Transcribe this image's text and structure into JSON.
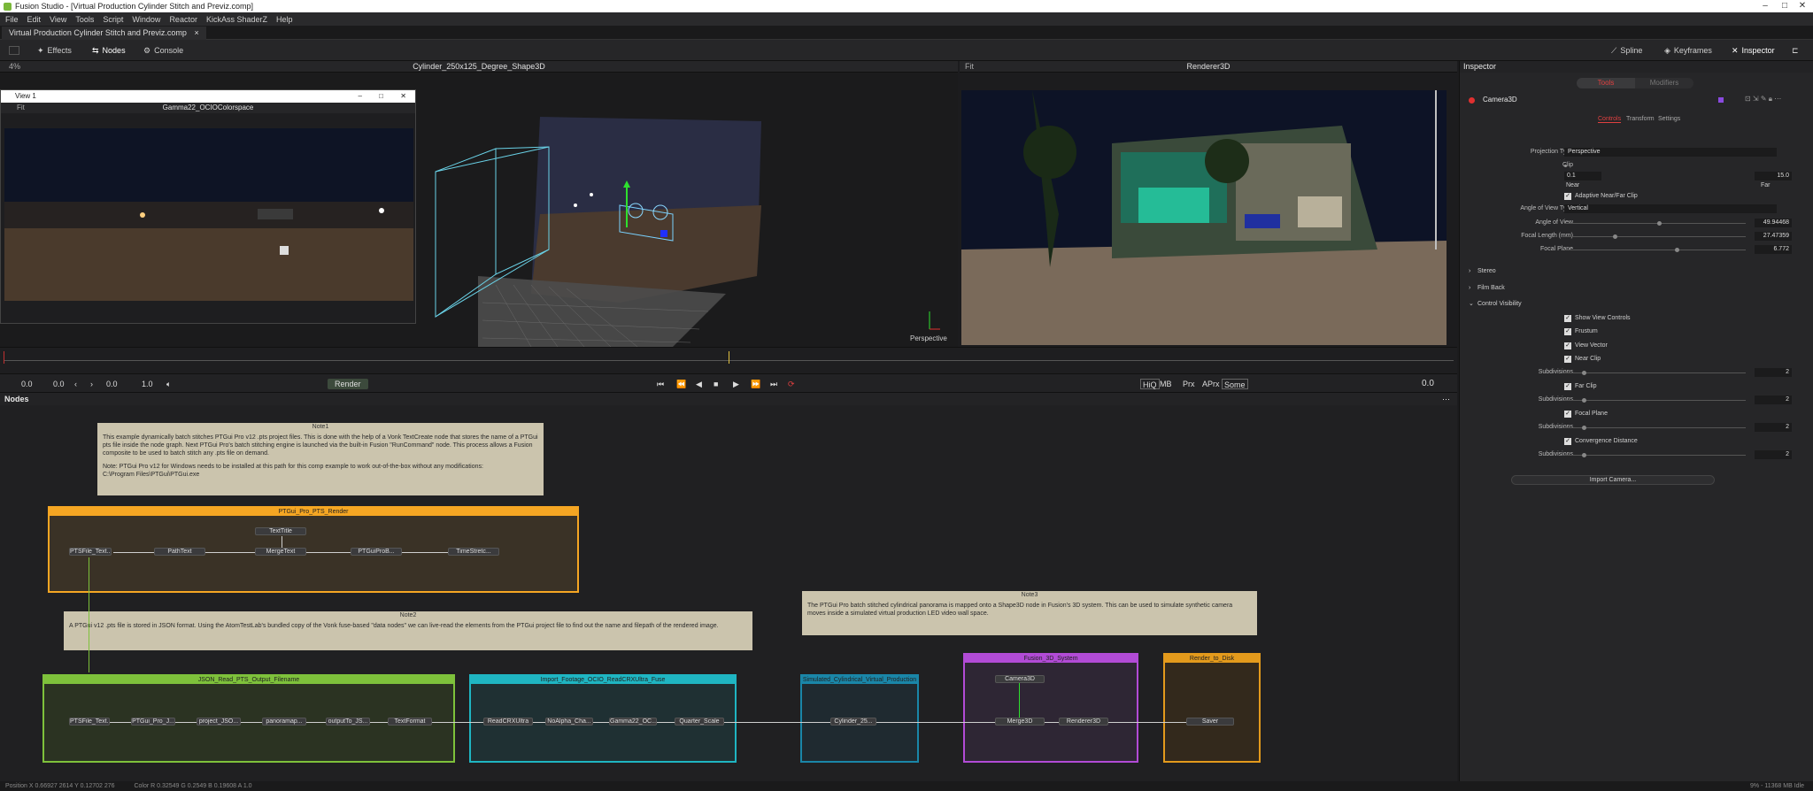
{
  "window": {
    "title": "Fusion Studio - [Virtual Production Cylinder Stitch and Previz.comp]"
  },
  "menu": [
    "File",
    "Edit",
    "View",
    "Tools",
    "Script",
    "Window",
    "Reactor",
    "KickAss ShaderZ",
    "Help"
  ],
  "doc_tab": {
    "label": "Virtual Production Cylinder Stitch and Previz.comp",
    "close": "×"
  },
  "toolbar": {
    "effects": "Effects",
    "nodes": "Nodes",
    "console": "Console",
    "spline": "Spline",
    "keyframes": "Keyframes",
    "inspector": "Inspector"
  },
  "viewer_left": {
    "title": "Cylinder_250x125_Degree_Shape3D",
    "perspective": "Perspective",
    "zoom": "4%"
  },
  "viewer_right": {
    "title": "Renderer3D",
    "fit": "Fit"
  },
  "floating_view": {
    "title": "View 1",
    "label": "Gamma22_OCIOColorspace",
    "fit": "Fit"
  },
  "transport": {
    "start": "0.0",
    "render_start": "0.0",
    "current": "0.0",
    "end": "1.0",
    "render_btn": "Render",
    "hiq": "HiQ",
    "mb": "MB",
    "prx": "Prx",
    "aprx": "APrx",
    "some": "Some",
    "time": "0.0"
  },
  "nodes_panel": {
    "title": "Nodes"
  },
  "notes": {
    "note1": {
      "title": "Note1",
      "p1": "This example dynamically batch stitches PTGui Pro v12 .pts project files. This is done with the help of a Vonk TextCreate node that stores the name of a PTGui pts file inside the node graph. Next PTGui Pro's batch stitching engine is launched via the built-in Fusion \"RunCommand\" node. This process allows a Fusion composite to be used to batch stitch any .pts file on demand.",
      "p2": "Note: PTGui Pro v12 for Windows needs to be installed at this path for this comp example to work out-of-the-box without any modifications:",
      "p3": "C:\\Program Files\\PTGui\\PTGui.exe"
    },
    "note2": {
      "title": "Note2",
      "p1": "A PTGui v12 .pts file is stored in JSON format. Using the AtomTestLab's bundled copy of the Vonk fuse-based \"data nodes\" we can live-read the elements from the PTGui project file to find out the name and filepath of the rendered image."
    },
    "note3": {
      "title": "Note3",
      "p1": "The PTGui Pro batch stitched cylindrical panorama is mapped onto a Shape3D node in Fusion's 3D system. This can be used to simulate synthetic camera moves inside a simulated virtual production LED video wall space."
    }
  },
  "groups": {
    "ptgui": {
      "title": "PTGui_Pro_PTS_Render",
      "color": "#f5a623"
    },
    "json": {
      "title": "JSON_Read_PTS_Output_Filename",
      "color": "#7ec13b"
    },
    "import": {
      "title": "Import_Footage_OCIO_ReadCRXUltra_Fuse",
      "color": "#1fb5c2"
    },
    "simulate": {
      "title": "Simulated_Cylindrical_Virtual_Production",
      "color": "#1a86a8"
    },
    "fusion3d": {
      "title": "Fusion_3D_System",
      "color": "#b24bd6"
    },
    "render": {
      "title": "Render_to_Disk",
      "color": "#e39a1c"
    }
  },
  "nodes": {
    "ptsfile_text_a": "PTSFile_Text...",
    "pathtext": "PathText",
    "texttitle": "TextTitle",
    "mergetext": "MergeText",
    "ptguiprob": "PTGuiProB...",
    "timestretch": "TimeStretc...",
    "ptsfile_text_b": "PTSFile_Text...",
    "ptgui_pro": "PTGui_Pro_J...",
    "project_json": "project_JSO...",
    "panorama": "panoramap...",
    "outputto": "outputTo_JS...",
    "textformat": "TextFormat",
    "readcrx": "ReadCRXUltra",
    "noalpha": "NoAlpha_Cha...",
    "gamma22": "Gamma22_OC...",
    "quarter": "Quarter_Scale",
    "cylinder": "Cylinder_25...",
    "camera3d": "Camera3D",
    "merge3d": "Merge3D",
    "renderer3d": "Renderer3D",
    "saver": "Saver"
  },
  "inspector": {
    "title": "Inspector",
    "tab_tools": "Tools",
    "tab_modifiers": "Modifiers",
    "node_name": "Camera3D",
    "subtabs": [
      "Controls",
      "Transform",
      "Settings"
    ],
    "projection_type_label": "Projection Type",
    "projection_type": "Perspective",
    "clip_label": "Clip",
    "near_val": "0.1",
    "far_val": "15.0",
    "near_label": "Near",
    "far_label": "Far",
    "adaptive": "Adaptive Near/Far Clip",
    "angle_type_label": "Angle of View Type",
    "angle_type": "Vertical",
    "angle_label": "Angle of View",
    "angle_val": "49.94468",
    "focal_label": "Focal Length (mm)",
    "focal_val": "27.47359",
    "plane_label": "Focal Plane",
    "plane_val": "6.772",
    "stereo": "Stereo",
    "filmback": "Film Back",
    "control_vis": "Control Visibility",
    "show_view": "Show View Controls",
    "frustum": "Frustum",
    "view_vector": "View Vector",
    "near_clip": "Near Clip",
    "subdiv_label": "Subdivisions",
    "subdiv_val": "2",
    "far_clip": "Far Clip",
    "focal_plane": "Focal Plane",
    "convergence": "Convergence Distance",
    "import_btn": "Import Camera..."
  },
  "status": {
    "position": "Position X 0.66927  2614  Y 0.12702  276",
    "color": "Color R 0.32549  G 0.2549  B 0.19608  A 1.0",
    "memory": "9% - 11368 MB  Idle"
  }
}
